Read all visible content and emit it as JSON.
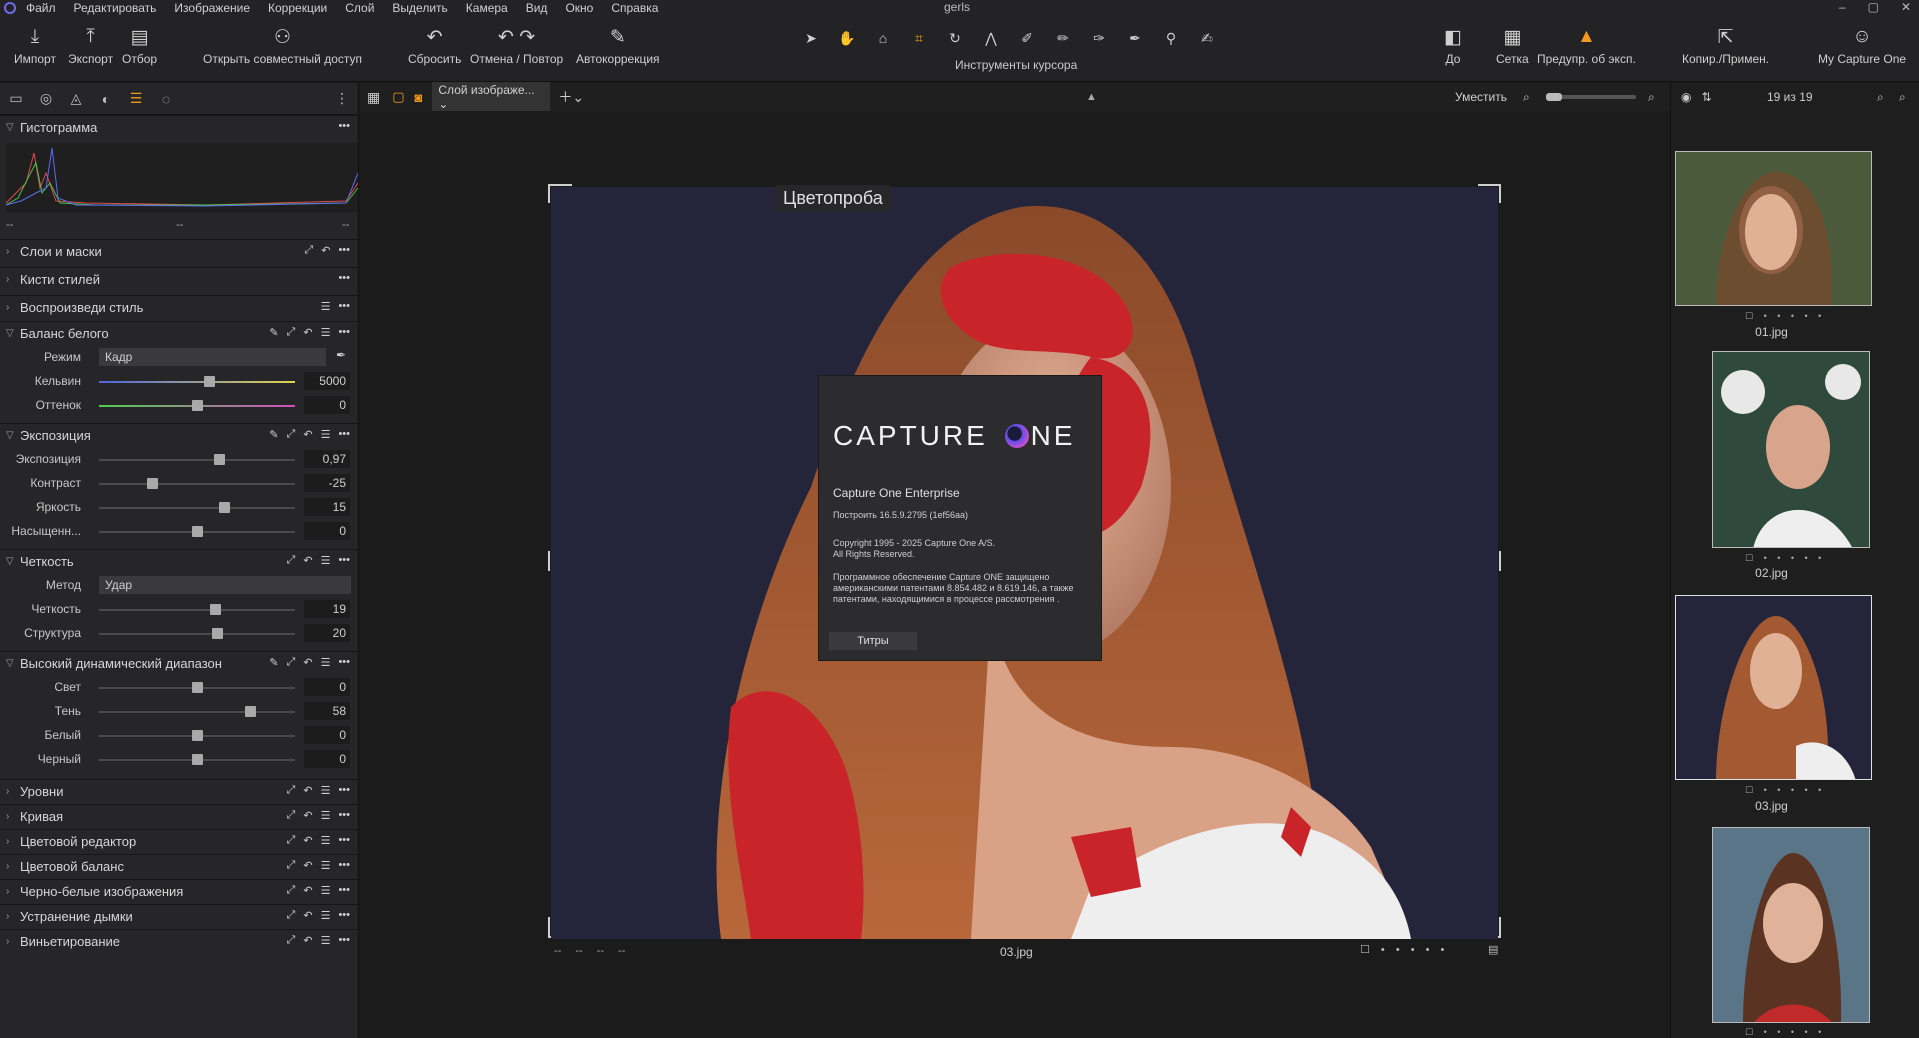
{
  "menu": [
    "Файл",
    "Редактировать",
    "Изображение",
    "Коррекции",
    "Слой",
    "Выделить",
    "Камера",
    "Вид",
    "Окно",
    "Справка"
  ],
  "window_title": "gerls",
  "toolbar": {
    "import": "Импорт",
    "export": "Экспорт",
    "cull": "Отбор",
    "share": "Открыть совместный доступ",
    "reset": "Сбросить",
    "undo_redo": "Отмена / Повтор",
    "autocorrect": "Автокоррекция",
    "cursor_tools": "Инструменты курсора",
    "before": "До",
    "grid": "Сетка",
    "exposure_warning": "Предупр. об эксп.",
    "copy_apply": "Копир./Примен.",
    "my_capture_one": "My Capture One"
  },
  "panels": {
    "histogram": "Гистограмма",
    "histogram_readout": [
      "--",
      "--",
      "--"
    ],
    "layers": "Слои и маски",
    "style_brushes": "Кисти стилей",
    "reproduce_style": "Воспроизведи стиль",
    "white_balance": {
      "title": "Баланс белого",
      "mode_label": "Режим",
      "mode_value": "Кадр",
      "kelvin_label": "Кельвин",
      "kelvin_value": "5000",
      "kelvin_pos": 0.56,
      "tint_label": "Оттенок",
      "tint_value": "0",
      "tint_pos": 0.5
    },
    "exposure": {
      "title": "Экспозиция",
      "rows": [
        {
          "label": "Экспозиция",
          "value": "0,97",
          "pos": 0.61
        },
        {
          "label": "Контраст",
          "value": "-25",
          "pos": 0.27
        },
        {
          "label": "Яркость",
          "value": "15",
          "pos": 0.64
        },
        {
          "label": "Насыщенн...",
          "value": "0",
          "pos": 0.5
        }
      ]
    },
    "clarity": {
      "title": "Четкость",
      "method_label": "Метод",
      "method_value": "Удар",
      "rows": [
        {
          "label": "Четкость",
          "value": "19",
          "pos": 0.59
        },
        {
          "label": "Структура",
          "value": "20",
          "pos": 0.6
        }
      ]
    },
    "hdr": {
      "title": "Высокий динамический диапазон",
      "rows": [
        {
          "label": "Свет",
          "value": "0",
          "pos": 0.5
        },
        {
          "label": "Тень",
          "value": "58",
          "pos": 0.77
        },
        {
          "label": "Белый",
          "value": "0",
          "pos": 0.5
        },
        {
          "label": "Черный",
          "value": "0",
          "pos": 0.5
        }
      ]
    },
    "collapsed": [
      "Уровни",
      "Кривая",
      "Цветовой редактор",
      "Цветовой баланс",
      "Черно-белые изображения",
      "Устранение дымки",
      "Виньетирование"
    ]
  },
  "viewbar": {
    "layer_select": "Слой изображе...",
    "fit": "Уместить",
    "count": "19 из 19"
  },
  "viewer": {
    "overlay_label": "Цветопроба",
    "filename": "03.jpg",
    "readouts": [
      "--",
      "--",
      "--",
      "--"
    ]
  },
  "about": {
    "logo_left": "CAPTURE",
    "logo_right": "NE",
    "product": "Capture One Enterprise",
    "build": "Построить 16.5.9.2795 (1ef56aa)",
    "copyright1": "Copyright 1995 - 2025 Capture One A/S.",
    "copyright2": "All Rights Reserved.",
    "patent1": "Программное обеспечение Capture ONE защищено",
    "patent2": "американскими патентами   8.854.482 и 8.619.146, а также",
    "patent3": "патентами, находящимися в процессе рассмотрения .",
    "credits": "Титры"
  },
  "browser": {
    "files": [
      "01.jpg",
      "02.jpg",
      "03.jpg",
      ""
    ]
  },
  "colors": {
    "accent": "#f29a1d",
    "mask_red": "#c8242a",
    "backdrop": "#24243a"
  }
}
